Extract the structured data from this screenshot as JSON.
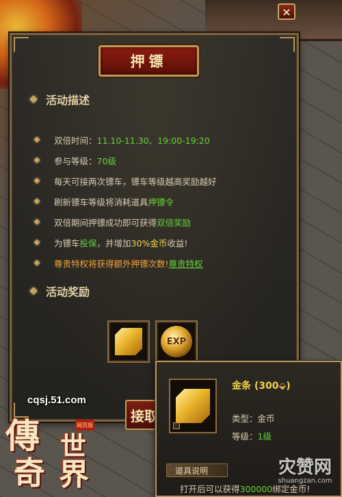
{
  "window": {
    "title": "押镖",
    "close_label": "×"
  },
  "description": {
    "heading": "活动描述",
    "items": [
      {
        "parts": [
          {
            "text": "双倍时间：",
            "style": ""
          },
          {
            "text": "11.10-11.30、19:00-19:20",
            "style": "hl-green"
          }
        ]
      },
      {
        "parts": [
          {
            "text": "参与等级：",
            "style": ""
          },
          {
            "text": "70级",
            "style": "hl-green"
          }
        ]
      },
      {
        "parts": [
          {
            "text": "每天可接两次镖车，镖车等级越高奖励越好",
            "style": ""
          }
        ]
      },
      {
        "parts": [
          {
            "text": "刷新镖车等级将消耗道具",
            "style": ""
          },
          {
            "text": "押镖令",
            "style": "hl-green"
          }
        ]
      },
      {
        "parts": [
          {
            "text": "双倍期间押镖成功即可获得",
            "style": ""
          },
          {
            "text": "双倍奖励",
            "style": "hl-green"
          }
        ]
      },
      {
        "parts": [
          {
            "text": "为镖车",
            "style": ""
          },
          {
            "text": "投保",
            "style": "hl-green"
          },
          {
            "text": "，并增加 ",
            "style": ""
          },
          {
            "text": "30%金币",
            "style": "hl-yellow"
          },
          {
            "text": "收益!",
            "style": ""
          }
        ]
      },
      {
        "parts": [
          {
            "text": "尊贵特权将获得额外押镖次数! ",
            "style": "hl-orange"
          },
          {
            "text": "尊贵特权",
            "style": "link"
          }
        ]
      }
    ]
  },
  "rewards": {
    "heading": "活动奖励",
    "items": [
      {
        "name": "gold-bar-icon"
      },
      {
        "name": "exp-orb-icon",
        "label": "EXP"
      }
    ]
  },
  "accept_button": {
    "label": "接取"
  },
  "tooltip": {
    "item_name": "金条 (300",
    "type_label": "类型：",
    "type_value": "金币",
    "level_label": "等级：",
    "level_value": "1级",
    "section_label": "道具说明",
    "desc_prefix": "打开后可以获得",
    "desc_number": "300000",
    "desc_suffix": "绑定金币!"
  },
  "branding": {
    "site_url": "cqsj.51.com",
    "logo_chars": [
      "傳",
      "世",
      "奇",
      "界"
    ],
    "logo_stamp": "网页版",
    "watermark_main": "灾赞网",
    "watermark_sub": "shuangzan.com"
  },
  "colors": {
    "accent_gold": "#c29a5a",
    "title_red": "#8c1d10",
    "highlight_green": "#62d33a",
    "highlight_yellow": "#f2d24a",
    "highlight_orange": "#f0a43a"
  }
}
